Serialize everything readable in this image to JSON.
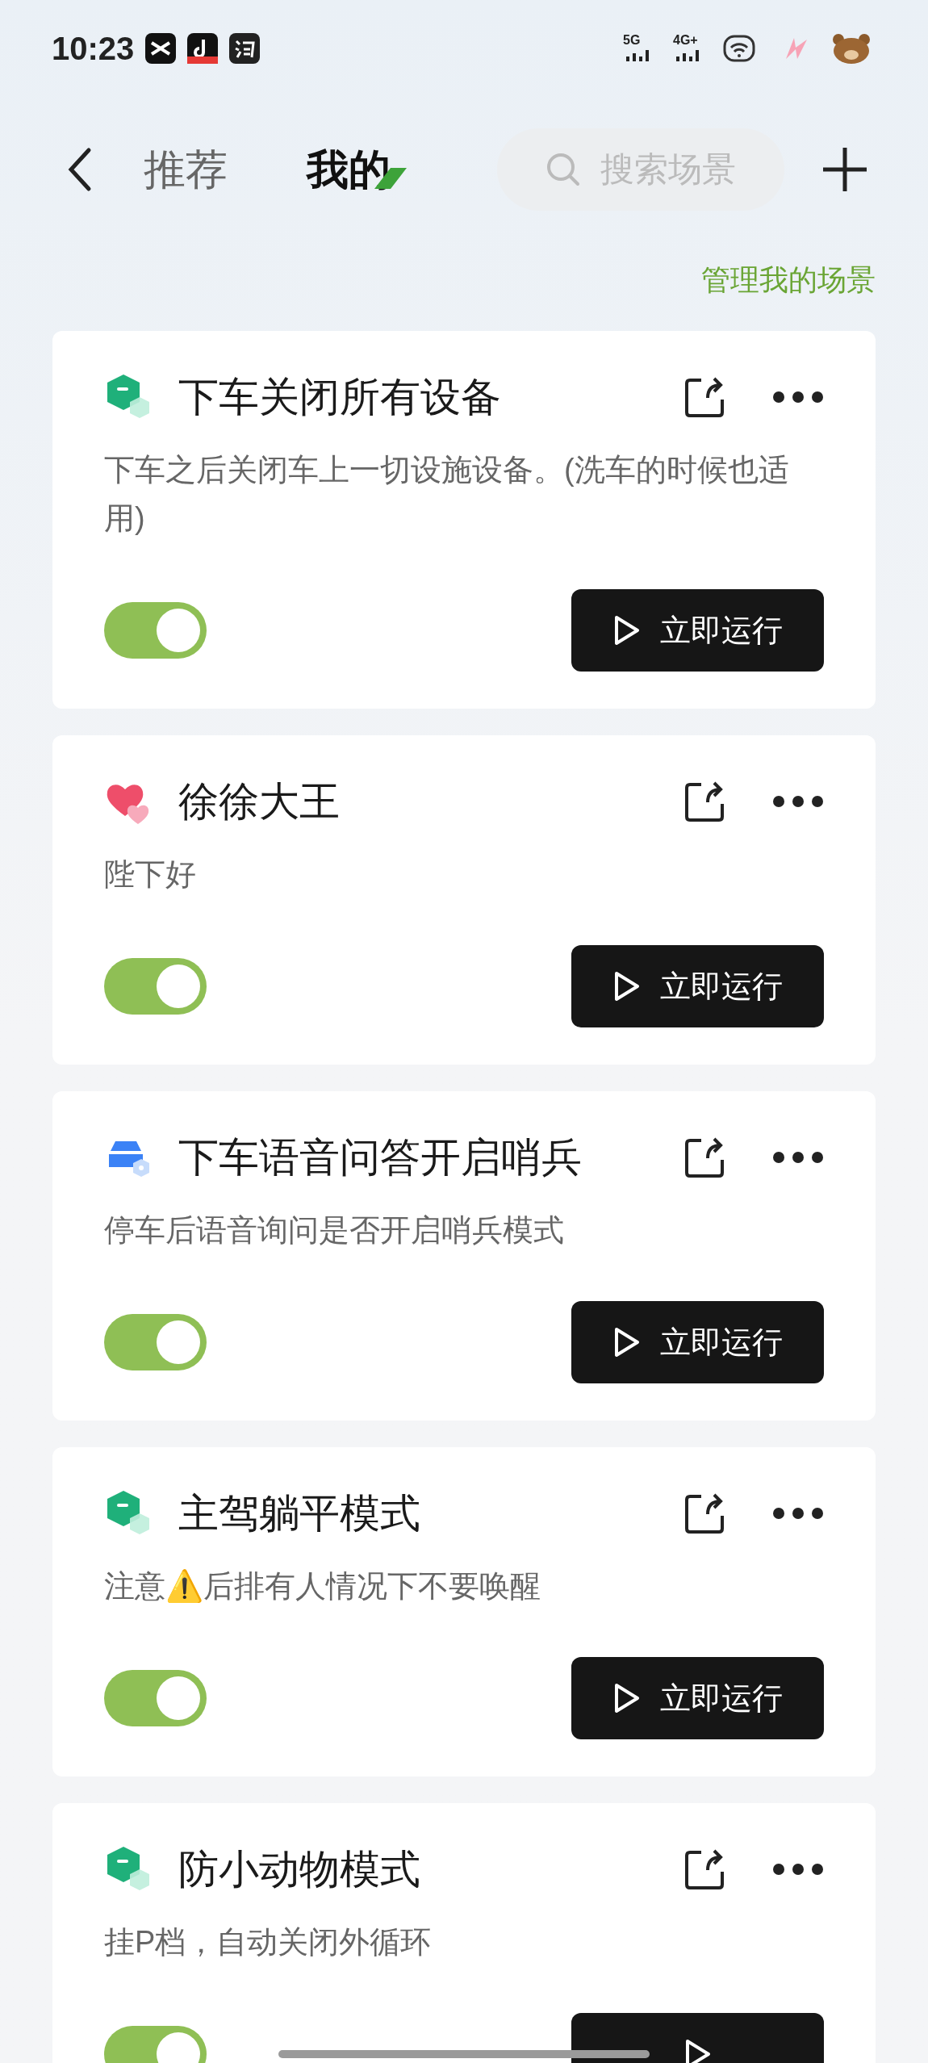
{
  "status_bar": {
    "time": "10:23",
    "networks": [
      "5G",
      "4G+"
    ]
  },
  "tabs": [
    {
      "label": "推荐",
      "selected": false
    },
    {
      "label": "我的",
      "selected": true
    }
  ],
  "search": {
    "placeholder": "搜索场景"
  },
  "manage_link": "管理我的场景",
  "scenes": [
    {
      "kind": "hexagon",
      "title": "下车关闭所有设备",
      "description": "下车之后关闭车上一切设施设备。(洗车的时候也适用)",
      "on": true,
      "run_label": "立即运行"
    },
    {
      "kind": "hearts",
      "title": "徐徐大王",
      "description": "陛下好",
      "on": true,
      "run_label": "立即运行"
    },
    {
      "kind": "car",
      "title": "下车语音问答开启哨兵",
      "description": "停车后语音询问是否开启哨兵模式",
      "on": true,
      "run_label": "立即运行"
    },
    {
      "kind": "hexagon",
      "title": "主驾躺平模式",
      "description": "注意⚠️后排有人情况下不要唤醒",
      "on": true,
      "run_label": "立即运行"
    },
    {
      "kind": "hexagon",
      "title": "防小动物模式",
      "description": "挂P档，自动关闭外循环",
      "on": true
    }
  ]
}
